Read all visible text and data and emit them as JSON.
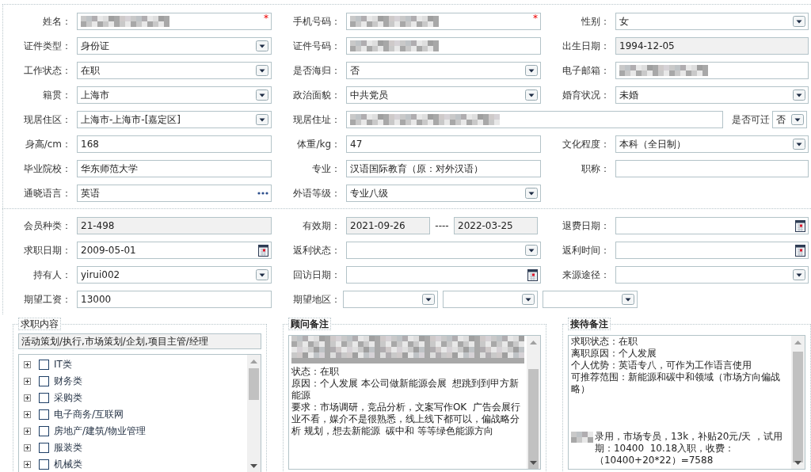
{
  "personal_fields": [
    {
      "label": "姓名：",
      "kind": "text",
      "redacted": true,
      "required_mark": "*"
    },
    {
      "label": "手机号码：",
      "kind": "text",
      "redacted": true,
      "required_mark": "*"
    },
    {
      "label": "性别：",
      "kind": "select",
      "value": "女"
    },
    {
      "label": "证件类型：",
      "kind": "select",
      "value": "身份证"
    },
    {
      "label": "证件号码：",
      "kind": "text",
      "redacted": true
    },
    {
      "label": "出生日期：",
      "kind": "text",
      "value": "1994-12-05",
      "readonly": true
    },
    {
      "label": "工作状态：",
      "kind": "select",
      "value": "在职"
    },
    {
      "label": "是否海归：",
      "kind": "select",
      "value": "否"
    },
    {
      "label": "电子邮箱：",
      "kind": "text",
      "redacted": true
    },
    {
      "label": "籍贯：",
      "kind": "select",
      "value": "上海市"
    },
    {
      "label": "政治面貌：",
      "kind": "select",
      "value": "中共党员"
    },
    {
      "label": "婚育状况：",
      "kind": "select",
      "value": "未婚"
    },
    {
      "label": "现居住区：",
      "kind": "select",
      "value": "上海市-上海市-[嘉定区]"
    },
    {
      "label": "现居住址：",
      "kind": "text",
      "redacted": true,
      "extra": {
        "label": "是否可迁",
        "kind": "select",
        "value": "否"
      }
    },
    {
      "label": "身高/cm：",
      "kind": "text",
      "value": "168"
    },
    {
      "label": "体重/kg：",
      "kind": "text",
      "value": "47"
    },
    {
      "label": "文化程度：",
      "kind": "select",
      "value": "本科（全日制）"
    },
    {
      "label": "毕业院校：",
      "kind": "text",
      "value": "华东师范大学"
    },
    {
      "label": "专业：",
      "kind": "text",
      "value": "汉语国际教育（原：对外汉语）"
    },
    {
      "label": "职称：",
      "kind": "text"
    },
    {
      "label": "通晓语言：",
      "kind": "lookup",
      "value": "英语"
    },
    {
      "label": "外语等级：",
      "kind": "select",
      "value": "专业八级"
    }
  ],
  "membership_fields": [
    {
      "label": "会员种类：",
      "kind": "text",
      "value": "21-498",
      "readonly": true
    },
    {
      "label": "有效期：",
      "kind": "range",
      "from": "2021-09-26",
      "separator": "----",
      "to": "2022-03-25",
      "readonly": true
    },
    {
      "label": "退费日期：",
      "kind": "date"
    },
    {
      "label": "求职日期：",
      "kind": "date",
      "value": "2009-05-01"
    },
    {
      "label": "返利状态：",
      "kind": "select"
    },
    {
      "label": "返利时间：",
      "kind": "date"
    },
    {
      "label": "持有人：",
      "kind": "select",
      "value": "yirui002"
    },
    {
      "label": "回访日期：",
      "kind": "date"
    },
    {
      "label": "来源途径：",
      "kind": "select"
    },
    {
      "label": "期望工资：",
      "kind": "text",
      "value": "13000"
    },
    {
      "label": "期望地区：",
      "kind": "region",
      "selects": [
        {
          "kind": "select"
        },
        {
          "kind": "select"
        },
        {
          "kind": "select"
        }
      ]
    }
  ],
  "job_content": {
    "title": "求职内容",
    "selected_summary": "活动策划/执行,市场策划/企划,项目主管/经理",
    "categories": [
      {
        "label": "IT类",
        "checked": false,
        "expanded": false
      },
      {
        "label": "财务类",
        "checked": false,
        "expanded": false
      },
      {
        "label": "采购类",
        "checked": false,
        "expanded": false
      },
      {
        "label": "电子商务/互联网",
        "checked": false,
        "expanded": false
      },
      {
        "label": "房地产/建筑/物业管理",
        "checked": false,
        "expanded": false
      },
      {
        "label": "服装类",
        "checked": false,
        "expanded": false
      },
      {
        "label": "机械类",
        "checked": false,
        "expanded": false
      }
    ]
  },
  "notes": [
    {
      "title": "顾问备注",
      "paragraphs": [
        {
          "kind": "redacted"
        },
        {
          "kind": "text",
          "text": "状态：在职"
        },
        {
          "kind": "text",
          "text": "原因：个人发展 本公司做新能源会展  想跳到到甲方新能源"
        },
        {
          "kind": "text",
          "text": "要求：市场调研，竞品分析，文案写作OK  广告会展行业不看，媒介不是很熟悉，线上线下都可以，偏战略分析 规划，想去新能源  碳中和 等等绿色能源方向"
        }
      ]
    },
    {
      "title": "接待备注",
      "paragraphs": [
        {
          "kind": "text",
          "text": "求职状态：在职"
        },
        {
          "kind": "text",
          "text": "离职原因：个人发展"
        },
        {
          "kind": "text",
          "text": "个人优势：英语专八，可作为工作语言使用"
        },
        {
          "kind": "text",
          "text": "可推荐范围：新能源和碳中和领域（市场方向偏战略）"
        },
        {
          "kind": "redacted_prefix",
          "text": "录用，市场专员，13k，补贴20元/天 ，试用期：10400  10.18入职，收费：（10400+20*22）=7588"
        }
      ]
    }
  ]
}
